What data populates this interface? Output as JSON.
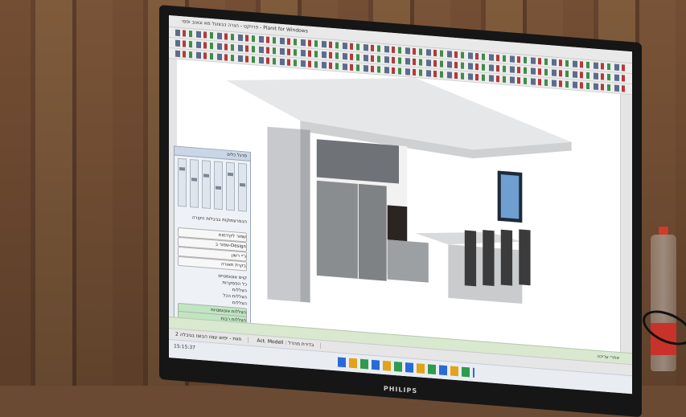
{
  "window": {
    "title": "‏פרויקט - הגרה כבצוגל מא וגאוב ופסי - Planit for Windows"
  },
  "viewport": {
    "colors": {
      "ceiling": "#e9e9e9",
      "wall": "#f6f6f6",
      "cabinet_dark": "#6f7276",
      "fridge": "#8a8d90",
      "pillar": "#c7c9cc"
    }
  },
  "side_panel": {
    "title": "סרגל כלים",
    "checkbox_option": "הבפרעתוקות בגיבלות הקורה",
    "rows": [
      "שמור לקידמות",
      "שמור ב-Design",
      "ג'יי רשון",
      "בקרת תאורה"
    ],
    "check_options": [
      "קוים אוטומטיים",
      "כל הפסקרות",
      "הצללות",
      "הצללות הכל",
      "הצללות"
    ],
    "green_buttons": [
      "הצללות אוטומטיות",
      "הצללות רבות"
    ]
  },
  "status_bar": {
    "text": "אחרי עריכה"
  },
  "tabs": [
    "2 חוות - יפוש עצוו הבוצו בגיבלה",
    "Act. Modell : בדירת מהדל"
  ],
  "taskbar": {
    "time": "15:15:37"
  },
  "monitor": {
    "brand": "PHILIPS"
  }
}
